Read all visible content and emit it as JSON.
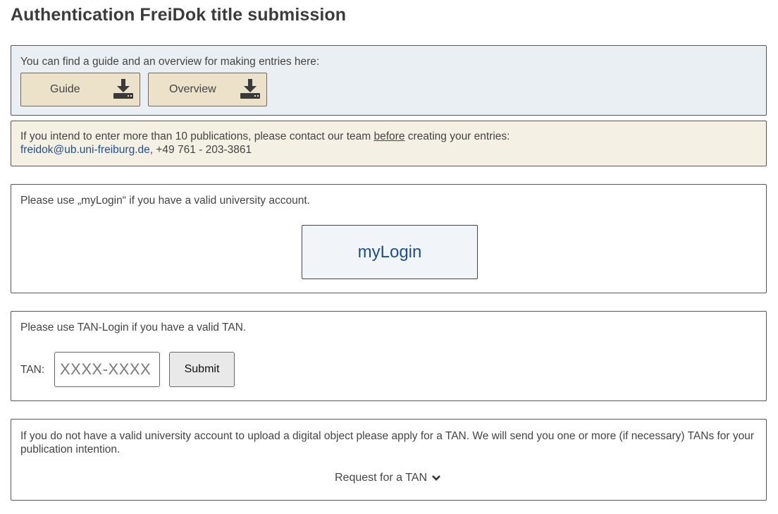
{
  "page": {
    "title": "Authentication FreiDok title submission"
  },
  "guide_box": {
    "text": "You can find a guide and an overview for making entries here:",
    "buttons": [
      {
        "label": "Guide",
        "icon": "download-icon"
      },
      {
        "label": "Overview",
        "icon": "download-icon"
      }
    ],
    "background": "#eaeff3",
    "button_color": "#ece1c9"
  },
  "notice_box": {
    "text_before": "If you intend to enter more than 10 publications, please contact our team ",
    "text_emphasis": "before",
    "text_after": " creating your entries:",
    "email": "freidok@ub.uni-freiburg.de",
    "phone": ", +49 761 - 203-3861",
    "background": "#f4f0e4"
  },
  "mylogin_box": {
    "text": "Please use „myLogin“ if you have a valid university account.",
    "button_label": "myLogin",
    "link_color": "#1e4f8c"
  },
  "tan_box": {
    "text": "Please use TAN-Login if you have a valid TAN.",
    "tan_label": "TAN:",
    "tan_placeholder": "XXXX-XXXX",
    "tan_value": "",
    "submit_label": "Submit"
  },
  "request_box": {
    "text": "If you do not have a valid university account to upload a digital object please apply for a TAN. We will send you one or more (if necessary) TANs for your publication intention.",
    "link_label": "Request for a TAN",
    "link_icon": "chevron-down-icon"
  }
}
